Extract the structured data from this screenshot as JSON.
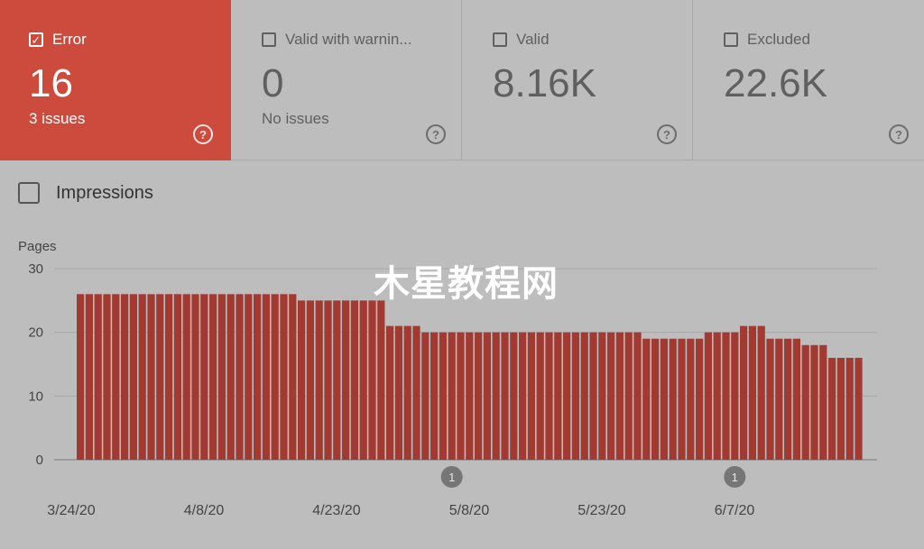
{
  "cards": [
    {
      "label": "Error",
      "value": "16",
      "sub": "3 issues",
      "checked": true,
      "help": "?"
    },
    {
      "label": "Valid with warnin...",
      "value": "0",
      "sub": "No issues",
      "checked": false,
      "help": "?"
    },
    {
      "label": "Valid",
      "value": "8.16K",
      "sub": "",
      "checked": false,
      "help": "?"
    },
    {
      "label": "Excluded",
      "value": "22.6K",
      "sub": "",
      "checked": false,
      "help": "?"
    }
  ],
  "impressions_label": "Impressions",
  "watermark": "木星教程网",
  "colors": {
    "error": "#cc4b3d",
    "bar": "#a33a31",
    "background": "#bdbdbd"
  },
  "chart_data": {
    "type": "bar",
    "ylabel": "Pages",
    "ylim": [
      0,
      30
    ],
    "yticks": [
      0,
      10,
      20,
      30
    ],
    "grid": true,
    "x_tick_labels": [
      "3/24/20",
      "4/8/20",
      "4/23/20",
      "5/8/20",
      "5/23/20",
      "6/7/20"
    ],
    "x_tick_index": [
      0,
      15,
      30,
      45,
      60,
      75
    ],
    "annotations": [
      {
        "index": 42,
        "label": "1"
      },
      {
        "index": 74,
        "label": "1"
      }
    ],
    "values": [
      26,
      26,
      26,
      26,
      26,
      26,
      26,
      26,
      26,
      26,
      26,
      26,
      26,
      26,
      26,
      26,
      26,
      26,
      26,
      26,
      26,
      26,
      26,
      26,
      26,
      25,
      25,
      25,
      25,
      25,
      25,
      25,
      25,
      25,
      25,
      21,
      21,
      21,
      21,
      20,
      20,
      20,
      20,
      20,
      20,
      20,
      20,
      20,
      20,
      20,
      20,
      20,
      20,
      20,
      20,
      20,
      20,
      20,
      20,
      20,
      20,
      20,
      20,
      20,
      19,
      19,
      19,
      19,
      19,
      19,
      19,
      20,
      20,
      20,
      20,
      21,
      21,
      21,
      19,
      19,
      19,
      19,
      18,
      18,
      18,
      16,
      16,
      16,
      16
    ]
  }
}
